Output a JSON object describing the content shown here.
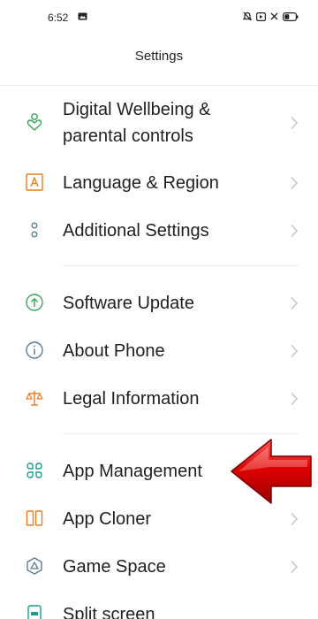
{
  "status_bar": {
    "time": "6:52"
  },
  "header": {
    "title": "Settings"
  },
  "items": [
    {
      "label_line1": "Digital Wellbeing &",
      "label_line2": "parental controls",
      "icon": "wellbeing-icon"
    },
    {
      "label": "Language & Region",
      "icon": "language-icon"
    },
    {
      "label": "Additional Settings",
      "icon": "additional-settings-icon"
    },
    {
      "label": "Software Update",
      "icon": "software-update-icon"
    },
    {
      "label": "About Phone",
      "icon": "info-icon"
    },
    {
      "label": "Legal Information",
      "icon": "scales-icon"
    },
    {
      "label": "App Management",
      "icon": "app-management-icon"
    },
    {
      "label": "App Cloner",
      "icon": "app-cloner-icon"
    },
    {
      "label": "Game Space",
      "icon": "game-space-icon"
    },
    {
      "label": "Split screen",
      "icon": "split-screen-icon"
    }
  ],
  "annotation": {
    "icon": "red-arrow-icon",
    "color": "#d40000"
  },
  "colors": {
    "green": "#3aa55b",
    "orange": "#e67e22",
    "blue_grey": "#5b7a99",
    "teal": "#1a9c8c",
    "chevron": "#c4c4c4"
  }
}
